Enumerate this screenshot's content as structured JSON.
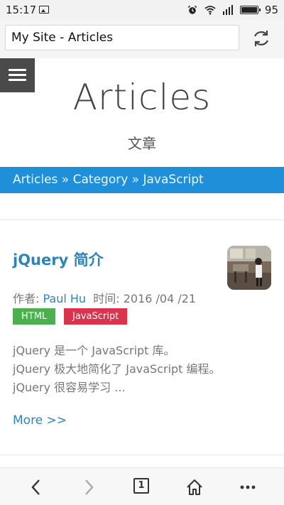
{
  "status_bar": {
    "time": "15:17",
    "battery": "95"
  },
  "browser": {
    "url": "My Site - Articles",
    "tab_count": "1"
  },
  "page": {
    "title": "Articles",
    "subtitle": "文章"
  },
  "breadcrumb": {
    "items": [
      "Articles",
      "Category",
      "JavaScript"
    ],
    "separator": " » "
  },
  "article": {
    "title": "jQuery 简介",
    "author_label": "作者: ",
    "author": "Paul Hu",
    "time_label": "时间: ",
    "time": "2016 /04 /21",
    "tags": [
      "HTML",
      "JavaScript"
    ],
    "excerpt_lines": [
      "jQuery 是一个 JavaScript 库。",
      "jQuery 极大地简化了 JavaScript 编程。",
      "jQuery 很容易学习 ..."
    ],
    "more_label": "More >>"
  },
  "colors": {
    "breadcrumb_bg": "#1e8fd8",
    "link": "#2d85b6",
    "tag_html": "#4cb050",
    "tag_js": "#d9334e"
  },
  "icons": [
    "image-icon",
    "alarm-icon",
    "wifi-icon",
    "signal-icon",
    "battery-icon",
    "refresh-icon",
    "menu-icon",
    "back-icon",
    "forward-icon",
    "home-icon",
    "more-icon"
  ]
}
